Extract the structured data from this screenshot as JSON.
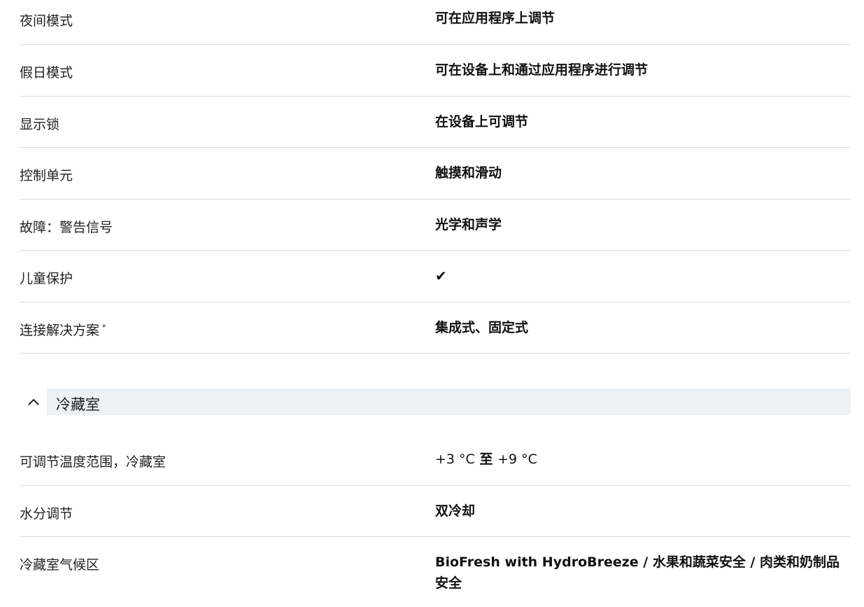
{
  "features": [
    {
      "label": "夜间模式",
      "value": "可在应用程序上调节"
    },
    {
      "label": "假日模式",
      "value": "可在设备上和通过应用程序进行调节"
    },
    {
      "label": "显示锁",
      "value": "在设备上可调节"
    },
    {
      "label": "控制单元",
      "value": "触摸和滑动"
    },
    {
      "label": "故障：警告信号",
      "value": "光学和声学"
    },
    {
      "label": "儿童保护",
      "value": "✔"
    },
    {
      "label": "连接解决方案",
      "footnote": "*",
      "value": "集成式、固定式"
    }
  ],
  "section": {
    "title": "冷藏室",
    "toggle_icon": "chevron-up-icon"
  },
  "fridge": [
    {
      "label": "可调节温度范围，冷藏室",
      "value_a": "+3 °C",
      "value_sep": "至",
      "value_b": "+9 °C"
    },
    {
      "label": "水分调节",
      "value": "双冷却"
    },
    {
      "label": "冷藏室气候区",
      "value": "BioFresh with HydroBreeze / 水果和蔬菜安全 / 肉类和奶制品安全"
    }
  ]
}
